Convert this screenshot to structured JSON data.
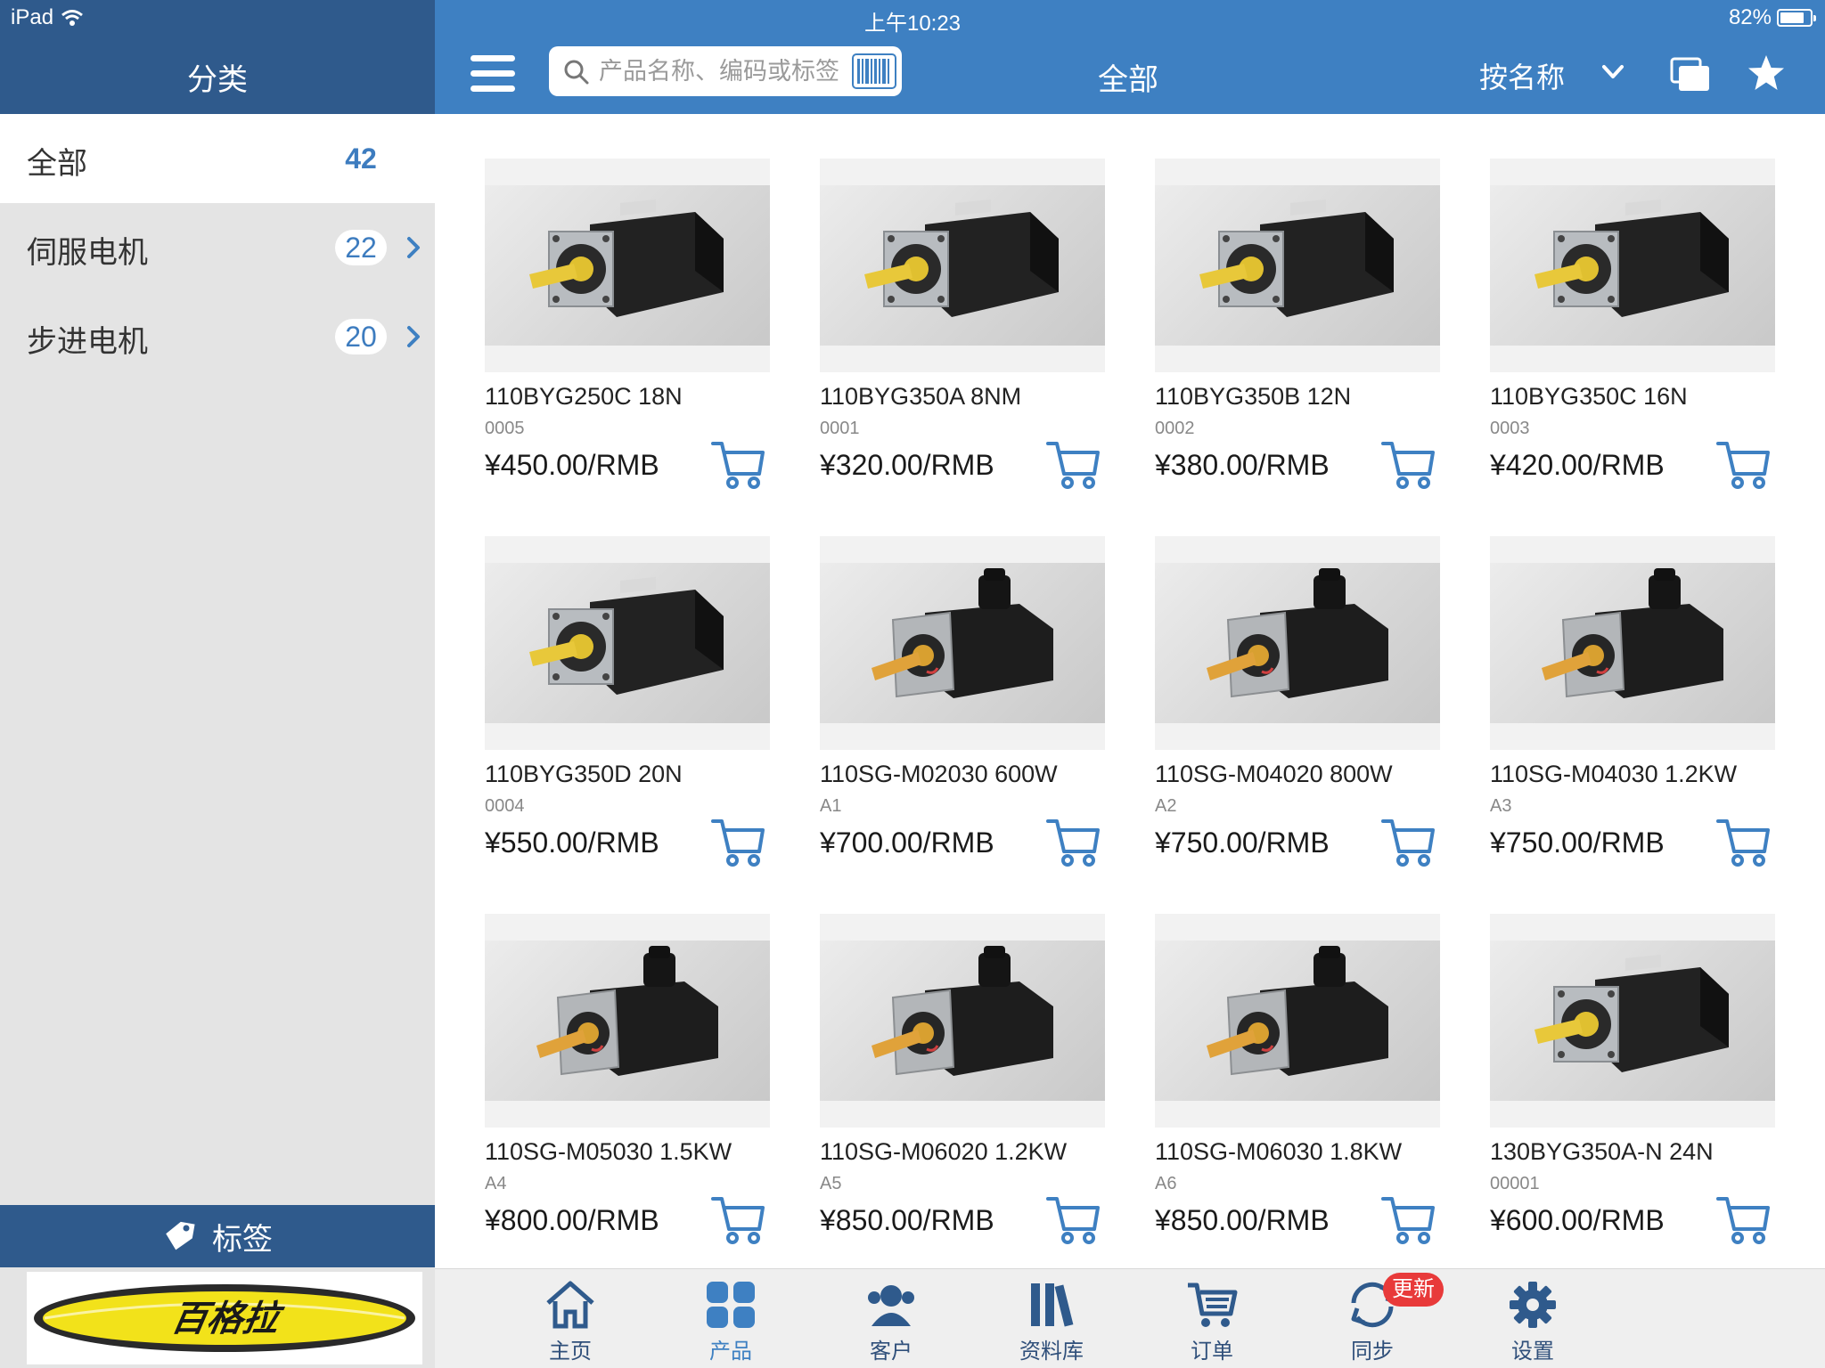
{
  "status": {
    "device": "iPad",
    "time": "上午10:23",
    "battery": "82%",
    "battery_level": 0.82
  },
  "sidebar": {
    "title": "分类",
    "categories": [
      {
        "label": "全部",
        "count": "42"
      },
      {
        "label": "伺服电机",
        "count": "22"
      },
      {
        "label": "步进电机",
        "count": "20"
      }
    ],
    "tags_label": "标签",
    "logo_text": "百格拉"
  },
  "topbar": {
    "search_placeholder": "产品名称、编码或标签",
    "title": "全部",
    "sort_label": "按名称"
  },
  "products": [
    {
      "name": "110BYG250C 18N",
      "code": "0005",
      "price": "¥450.00/RMB"
    },
    {
      "name": "110BYG350A 8NM",
      "code": "0001",
      "price": "¥320.00/RMB"
    },
    {
      "name": "110BYG350B 12N",
      "code": "0002",
      "price": "¥380.00/RMB"
    },
    {
      "name": "110BYG350C 16N",
      "code": "0003",
      "price": "¥420.00/RMB"
    },
    {
      "name": "110BYG350D 20N",
      "code": "0004",
      "price": "¥550.00/RMB"
    },
    {
      "name": "110SG-M02030 600W",
      "code": "A1",
      "price": "¥700.00/RMB"
    },
    {
      "name": "110SG-M04020 800W",
      "code": "A2",
      "price": "¥750.00/RMB"
    },
    {
      "name": "110SG-M04030 1.2KW",
      "code": "A3",
      "price": "¥750.00/RMB"
    },
    {
      "name": "110SG-M05030 1.5KW",
      "code": "A4",
      "price": "¥800.00/RMB"
    },
    {
      "name": "110SG-M06020 1.2KW",
      "code": "A5",
      "price": "¥850.00/RMB"
    },
    {
      "name": "110SG-M06030 1.8KW",
      "code": "A6",
      "price": "¥850.00/RMB"
    },
    {
      "name": "130BYG350A-N 24N",
      "code": "00001",
      "price": "¥600.00/RMB"
    }
  ],
  "tabs": [
    {
      "label": "主页",
      "icon": "home-icon"
    },
    {
      "label": "产品",
      "icon": "grid-icon"
    },
    {
      "label": "客户",
      "icon": "customers-icon"
    },
    {
      "label": "资料库",
      "icon": "library-icon"
    },
    {
      "label": "订单",
      "icon": "cart-icon"
    },
    {
      "label": "同步",
      "icon": "sync-icon",
      "badge": "更新"
    },
    {
      "label": "设置",
      "icon": "gear-icon"
    }
  ],
  "colors": {
    "header": "#3e80c2",
    "sidebar_header": "#2f5a8c",
    "accent": "#3e80c2",
    "badge": "#e83a3a"
  }
}
